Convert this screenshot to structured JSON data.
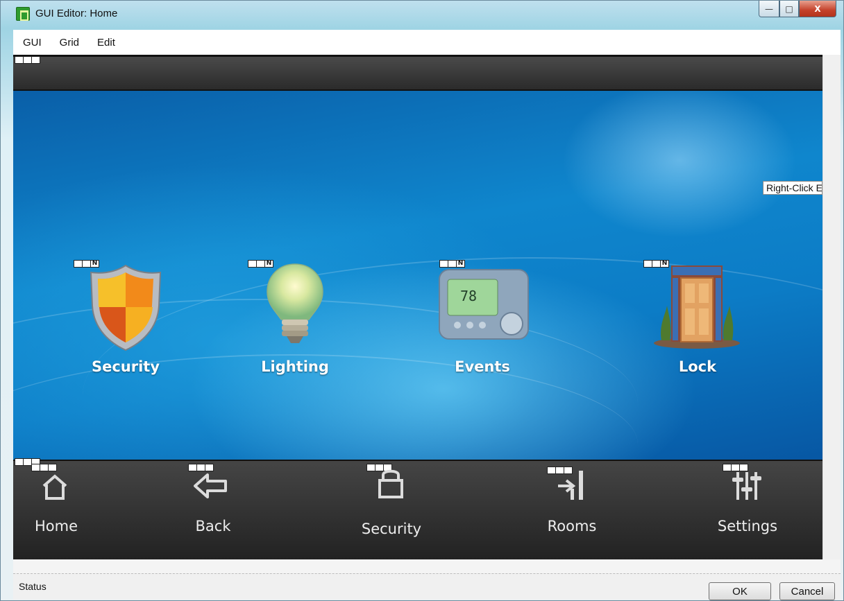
{
  "window": {
    "title": "GUI Editor: Home",
    "minimize": "—",
    "maximize": "□",
    "close": "X"
  },
  "menu": [
    "GUI",
    "Grid",
    "Edit"
  ],
  "canvas": {
    "hint": "Right-Click E",
    "handle_badge": "N",
    "tiles": [
      {
        "label": "Security",
        "icon": "shield-icon"
      },
      {
        "label": "Lighting",
        "icon": "lightbulb-icon"
      },
      {
        "label": "Events",
        "icon": "thermostat-icon"
      },
      {
        "label": "Lock",
        "icon": "door-icon"
      }
    ],
    "thermostat_reading": "78",
    "nav": [
      {
        "label": "Home",
        "icon": "home-icon"
      },
      {
        "label": "Back",
        "icon": "back-arrow-icon"
      },
      {
        "label": "Security",
        "icon": "lock-icon"
      },
      {
        "label": "Rooms",
        "icon": "rooms-door-icon"
      },
      {
        "label": "Settings",
        "icon": "sliders-icon"
      }
    ]
  },
  "status": {
    "text": "Status",
    "ok": "OK",
    "cancel": "Cancel"
  }
}
